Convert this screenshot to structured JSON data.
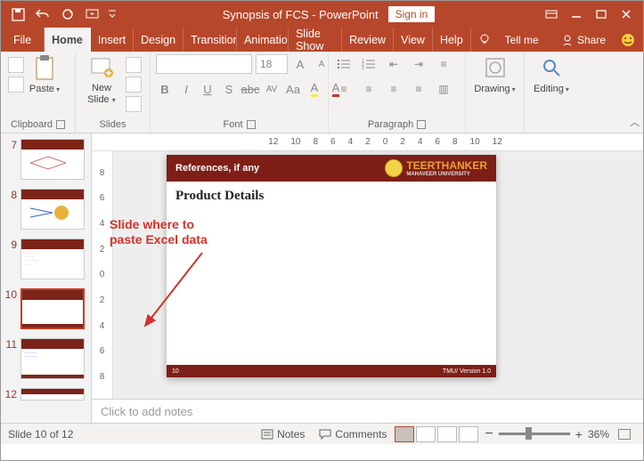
{
  "title": {
    "doc": "Synopsis of FCS",
    "app": "PowerPoint",
    "signin": "Sign in"
  },
  "tabs": {
    "file": "File",
    "home": "Home",
    "insert": "Insert",
    "design": "Design",
    "transitions": "Transitions",
    "animations": "Animations",
    "slideshow": "Slide Show",
    "review": "Review",
    "view": "View",
    "help": "Help",
    "tellme": "Tell me",
    "share": "Share"
  },
  "ribbon": {
    "paste": "Paste",
    "clipboard": "Clipboard",
    "newslide": "New",
    "slide2": "Slide",
    "slides": "Slides",
    "fontsize": "18",
    "font": "Font",
    "paragraph": "Paragraph",
    "drawing": "Drawing",
    "editing": "Editing"
  },
  "ruler_h": [
    "12",
    "10",
    "8",
    "6",
    "4",
    "2",
    "0",
    "2",
    "4",
    "6",
    "8",
    "10",
    "12"
  ],
  "ruler_v": [
    "8",
    "6",
    "4",
    "2",
    "0",
    "2",
    "4",
    "6",
    "8"
  ],
  "thumbs": [
    {
      "n": "7"
    },
    {
      "n": "8"
    },
    {
      "n": "9"
    },
    {
      "n": "10",
      "sel": true
    },
    {
      "n": "11"
    },
    {
      "n": "12"
    }
  ],
  "annotation": {
    "l1": "Slide where to",
    "l2": "paste Excel data"
  },
  "slide": {
    "refs": "References, if any",
    "brand1": "TEERTHANKER",
    "brand2": "MAHAVEER UNIVERSITY",
    "heading": "Product Details",
    "num": "10",
    "ver": "TMU/ Version 1.0"
  },
  "notes": "Click to add notes",
  "status": {
    "slide": "Slide 10 of 12",
    "notes": "Notes",
    "comments": "Comments",
    "zoom": "36%",
    "minus": "−",
    "plus": "+"
  }
}
